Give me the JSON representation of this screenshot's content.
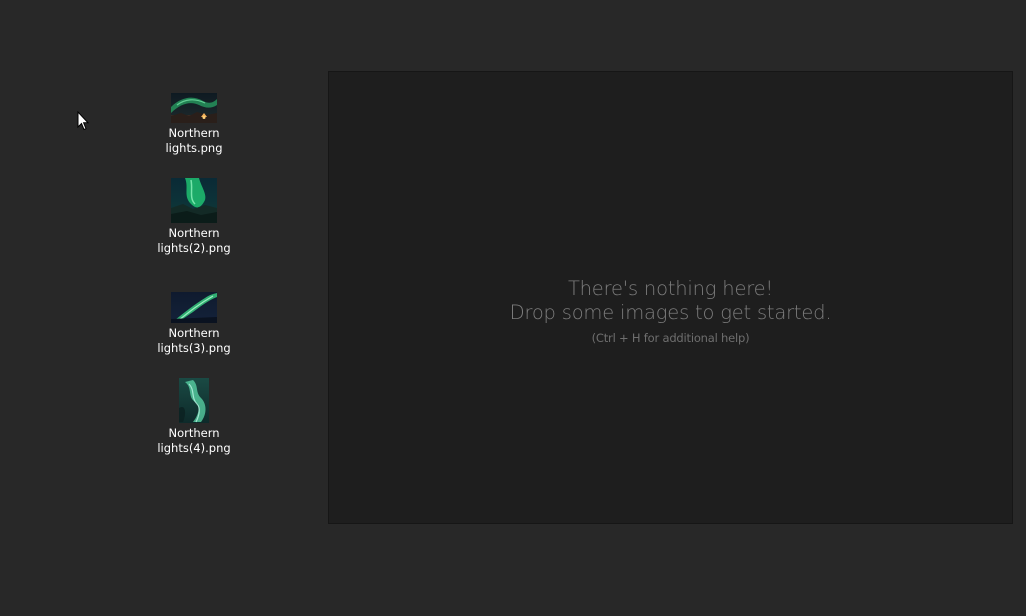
{
  "desktop": {
    "files": [
      {
        "line1": "Northern",
        "line2": "lights.png",
        "thumbnail": "northern-lights-thumbnail"
      },
      {
        "line1": "Northern",
        "line2": "lights(2).png",
        "thumbnail": "northern-lights-thumbnail"
      },
      {
        "line1": "Northern",
        "line2": "lights(3).png",
        "thumbnail": "northern-lights-thumbnail"
      },
      {
        "line1": "Northern",
        "line2": "lights(4).png",
        "thumbnail": "northern-lights-thumbnail"
      }
    ]
  },
  "drop_zone": {
    "line1": "There's nothing here!",
    "line2": "Drop some images to get started.",
    "hint": "(Ctrl + H for additional help)"
  },
  "colors": {
    "desktop_background": "#282828",
    "drop_zone_background": "#1e1e1e",
    "message_text": "#7d7d7d",
    "aurora_green": "#2fd17a"
  }
}
